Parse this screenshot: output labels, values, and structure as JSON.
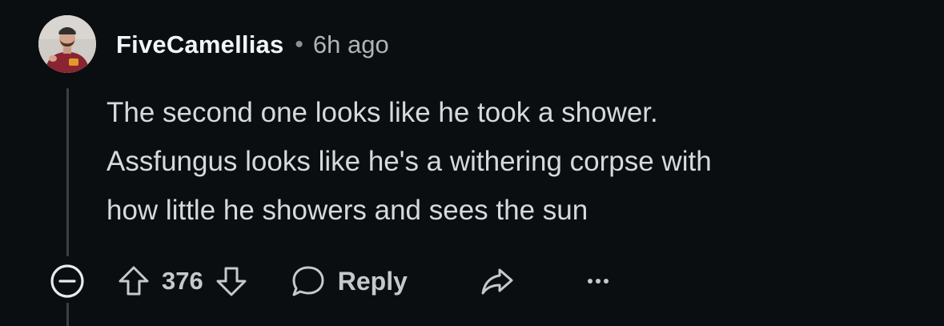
{
  "comment": {
    "author": "FiveCamellias",
    "separator": "•",
    "timestamp": "6h ago",
    "body_lines": [
      "The second one looks like he took a shower.",
      "Assfungus looks like he's a withering corpse with",
      "how little he showers and sees the sun"
    ],
    "avatar_icon": "user-avatar-photo"
  },
  "actions": {
    "collapse_icon": "minus-circle-icon",
    "upvote_icon": "arrow-up-icon",
    "score": "376",
    "downvote_icon": "arrow-down-icon",
    "reply_icon": "speech-bubble-icon",
    "reply_label": "Reply",
    "share_icon": "share-arrow-icon",
    "more_icon": "more-dots-icon"
  },
  "colors": {
    "background": "#0b0e11",
    "text_primary": "#f2f4f5",
    "text_body": "#d6dadc",
    "text_secondary": "#aeb4b8",
    "thread_line": "#3a3f44"
  }
}
